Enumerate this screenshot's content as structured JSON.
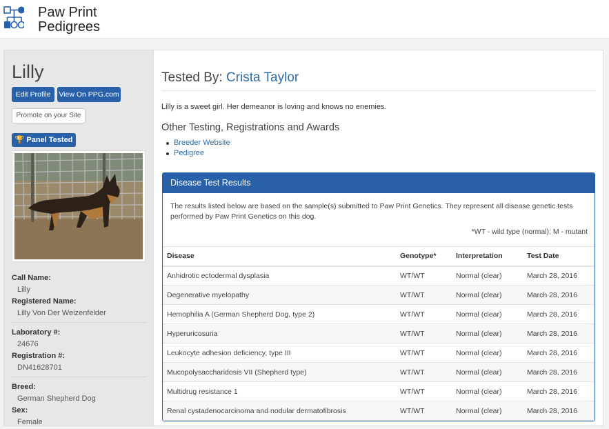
{
  "header": {
    "brand_line1": "Paw Print",
    "brand_line2": "Pedigrees"
  },
  "sidebar": {
    "dog_name": "Lilly",
    "edit_profile_label": "Edit Profile",
    "view_on_label": "View On PPG.com",
    "promote_label": "Promote on your Site",
    "badge_label": "Panel Tested",
    "details": [
      {
        "label": "Call Name:",
        "value": "Lilly"
      },
      {
        "label": "Registered Name:",
        "value": "Lilly Von Der Weizenfelder"
      },
      {
        "label": "Laboratory #:",
        "value": "24676"
      },
      {
        "label": "Registration #:",
        "value": "DN41628701"
      },
      {
        "label": "Breed:",
        "value": "German Shepherd Dog"
      },
      {
        "label": "Sex:",
        "value": "Female"
      }
    ]
  },
  "main": {
    "tested_by_label": "Tested By:",
    "tested_by_name": "Crista Taylor",
    "description": "Lilly is a sweet girl. Her demeanor is loving and knows no enemies.",
    "other_title": "Other Testing, Registrations and Awards",
    "links": [
      "Breeder Website",
      "Pedigree"
    ]
  },
  "results": {
    "title": "Disease Test Results",
    "note": "The results listed below are based on the sample(s) submitted to Paw Print Genetics. They represent all disease genetic tests performed by Paw Print Genetics on this dog.",
    "legend": "*WT - wild type (normal); M - mutant",
    "columns": [
      "Disease",
      "Genotype*",
      "Interpretation",
      "Test Date"
    ],
    "rows": [
      [
        "Anhidrotic ectodermal dysplasia",
        "WT/WT",
        "Normal (clear)",
        "March 28, 2016"
      ],
      [
        "Degenerative myelopathy",
        "WT/WT",
        "Normal (clear)",
        "March 28, 2016"
      ],
      [
        "Hemophilia A (German Shepherd Dog, type 2)",
        "WT/WT",
        "Normal (clear)",
        "March 28, 2016"
      ],
      [
        "Hyperuricosuria",
        "WT/WT",
        "Normal (clear)",
        "March 28, 2016"
      ],
      [
        "Leukocyte adhesion deficiency, type III",
        "WT/WT",
        "Normal (clear)",
        "March 28, 2016"
      ],
      [
        "Mucopolysaccharidosis VII (Shepherd type)",
        "WT/WT",
        "Normal (clear)",
        "March 28, 2016"
      ],
      [
        "Multidrug resistance 1",
        "WT/WT",
        "Normal (clear)",
        "March 28, 2016"
      ],
      [
        "Renal cystadenocarcinoma and nodular dermatofibrosis",
        "WT/WT",
        "Normal (clear)",
        "March 28, 2016"
      ]
    ]
  },
  "colors": {
    "primary": "#2860aa",
    "link": "#2f6da5"
  }
}
